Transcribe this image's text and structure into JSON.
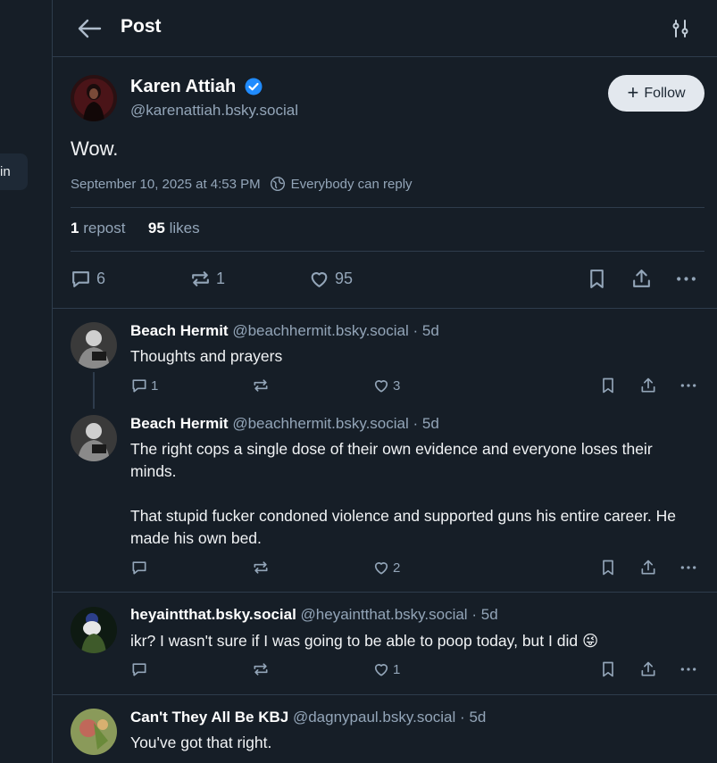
{
  "left": {
    "login_fragment": "in"
  },
  "header": {
    "title": "Post"
  },
  "post": {
    "author_name": "Karen Attiah",
    "author_handle": "@karenattiah.bsky.social",
    "follow_label": "Follow",
    "text": "Wow.",
    "timestamp": "September 10, 2025 at 4:53 PM",
    "reply_setting": "Everybody can reply",
    "repost_count": "1",
    "repost_label": "repost",
    "like_count": "95",
    "like_label": "likes",
    "actions": {
      "replies": "6",
      "reposts": "1",
      "likes": "95"
    }
  },
  "replies": [
    {
      "name": "Beach Hermit",
      "handle": "@beachhermit.bsky.social",
      "age": "5d",
      "text": "Thoughts and prayers",
      "replies": "1",
      "likes": "3"
    },
    {
      "name": "Beach Hermit",
      "handle": "@beachhermit.bsky.social",
      "age": "5d",
      "text_p1": "The right cops a single dose of their own evidence and everyone loses their minds.",
      "text_p2": "That stupid fucker condoned violence and supported guns his entire career. He made his own bed.",
      "likes": "2"
    },
    {
      "name": "heyaintthat.bsky.social",
      "handle": "@heyaintthat.bsky.social",
      "age": "5d",
      "text": "ikr? I wasn't sure if I was going to be able to poop today, but I did",
      "emoji": "😜",
      "likes": "1"
    },
    {
      "name": "Can't They All Be KBJ",
      "handle": "@dagnypaul.bsky.social",
      "age": "5d",
      "text": "You've got that right."
    }
  ],
  "separator": "·",
  "icons": [
    "back-arrow-icon",
    "filter-sliders-icon",
    "verified-badge-icon",
    "globe-icon",
    "reply-icon",
    "repost-icon",
    "like-icon",
    "bookmark-icon",
    "share-icon",
    "more-icon"
  ],
  "colors": {
    "background": "#161e27",
    "border": "#2e3c4c",
    "muted": "#93a5b8",
    "verified": "#208bfe",
    "follow_bg": "#e3e8ee"
  }
}
